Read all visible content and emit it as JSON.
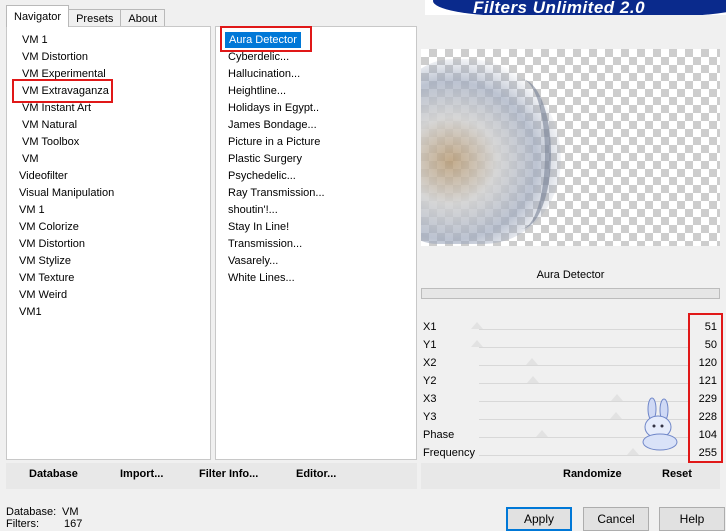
{
  "title": "Filters Unlimited 2.0",
  "tabs": [
    "Navigator",
    "Presets",
    "About"
  ],
  "navigator_items": [
    "VM 1",
    "VM Distortion",
    "VM Experimental",
    "VM Extravaganza",
    "VM Instant Art",
    "VM Natural",
    "VM Toolbox",
    "VM",
    "Videofilter",
    "Visual Manipulation",
    "VM 1",
    "VM Colorize",
    "VM Distortion",
    "VM Stylize",
    "VM Texture",
    "VM Weird",
    "VM1"
  ],
  "filter_items": [
    "Aura Detector",
    "Cyberdelic...",
    "Hallucination...",
    "Heightline...",
    "Holidays in Egypt..",
    "James Bondage...",
    "Picture in a Picture",
    "Plastic Surgery",
    "Psychedelic...",
    "Ray Transmission...",
    "shoutin'!...",
    "Stay In Line!",
    "Transmission...",
    "Vasarely...",
    "White Lines..."
  ],
  "selected_category": "VM Extravaganza",
  "selected_filter": "Aura Detector",
  "effect_name": "Aura Detector",
  "params": [
    {
      "label": "X1",
      "value": "51"
    },
    {
      "label": "Y1",
      "value": "50"
    },
    {
      "label": "X2",
      "value": "120"
    },
    {
      "label": "Y2",
      "value": "121"
    },
    {
      "label": "X3",
      "value": "229"
    },
    {
      "label": "Y3",
      "value": "228"
    },
    {
      "label": "Phase",
      "value": "104"
    },
    {
      "label": "Frequency",
      "value": "255"
    }
  ],
  "left_buttons": {
    "database": "Database",
    "import": "Import...",
    "filter_info": "Filter Info...",
    "editor": "Editor..."
  },
  "right_buttons": {
    "randomize": "Randomize",
    "reset": "Reset"
  },
  "status": {
    "database_label": "Database:",
    "database_value": "VM",
    "filters_label": "Filters:",
    "filters_value": "167"
  },
  "dialog_buttons": {
    "apply": "Apply",
    "cancel": "Cancel",
    "help": "Help"
  },
  "colors": {
    "accent": "#0078d7",
    "highlight_box": "#e01818",
    "banner": "#0a2a8c"
  }
}
